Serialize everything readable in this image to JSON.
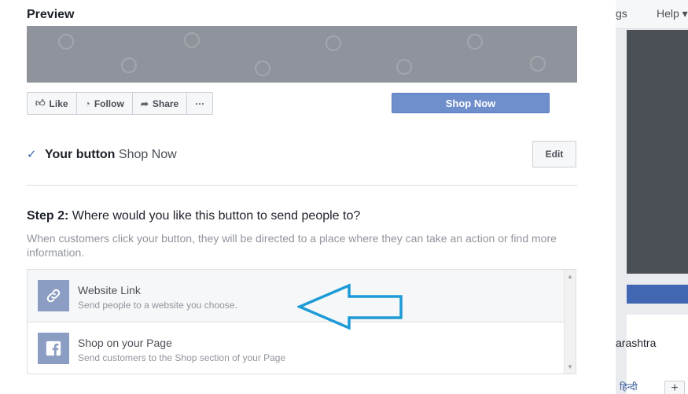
{
  "background_page": {
    "nav_settings": "gs",
    "nav_help": "Help",
    "location_text": "arashtra",
    "language_link": "हिन्दी",
    "plus_label": "+"
  },
  "preview": {
    "title": "Preview",
    "actions": [
      {
        "label": "Like",
        "icon": "thumbs-up-icon"
      },
      {
        "label": "Follow",
        "icon": "rss-icon"
      },
      {
        "label": "Share",
        "icon": "share-arrow-icon"
      },
      {
        "label": "···",
        "icon": "more-icon"
      }
    ],
    "cta_button": "Shop Now"
  },
  "selected_button": {
    "label": "Your button",
    "value": "Shop Now",
    "edit_label": "Edit"
  },
  "step2": {
    "step_label": "Step 2:",
    "question": "Where would you like this button to send people to?",
    "description": "When customers click your button, they will be directed to a place where they can take an action or find more information.",
    "options": [
      {
        "title": "Website Link",
        "subtitle": "Send people to a website you choose.",
        "icon": "link-icon"
      },
      {
        "title": "Shop on your Page",
        "subtitle": "Send customers to the Shop section of your Page",
        "icon": "facebook-icon"
      }
    ]
  },
  "colors": {
    "cta_blue": "#6f8fcc",
    "accent_blue": "#4267b2",
    "annotation_arrow": "#1e9bd7"
  }
}
